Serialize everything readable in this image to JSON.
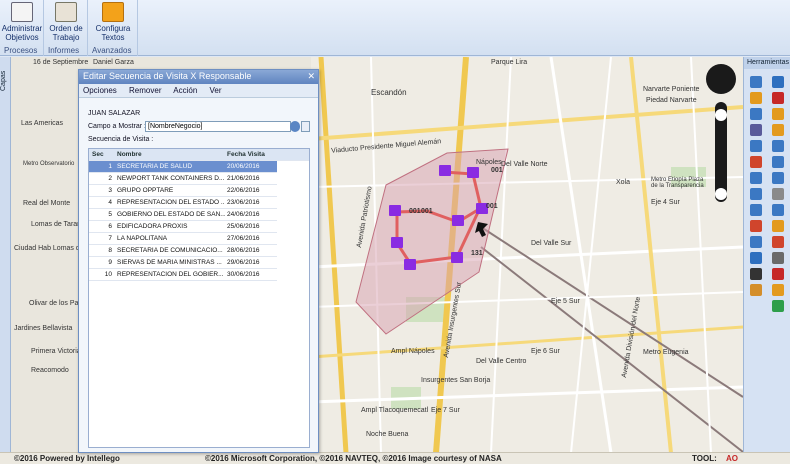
{
  "ribbon": {
    "groups": [
      {
        "label": "Procesos",
        "buttons": [
          {
            "label": "Administrar Objetivos",
            "icon": "clipboard-icon"
          }
        ]
      },
      {
        "label": "Informes",
        "buttons": [
          {
            "label": "Orden de Trabajo",
            "icon": "work-order-icon"
          }
        ]
      },
      {
        "label": "Avanzados",
        "buttons": [
          {
            "label": "Configura Textos",
            "icon": "edit-text-icon"
          }
        ]
      }
    ]
  },
  "side_tab": {
    "label": "Capas"
  },
  "tools": {
    "title": "Herramientas"
  },
  "map": {
    "labels": [
      "16 de Septiembre",
      "Daniel Garza",
      "Escandón",
      "Parque Lira",
      "Las Americas",
      "Metro Observatorio",
      "Real del Monte",
      "Lomas de Tarango",
      "Ciudad Hab Lomas de Santa Fe",
      "Olivar de los Padres",
      "Jardines Bellavista",
      "Primera Victoria",
      "Reacomodo",
      "Avenida Patriotismo",
      "Viaducto Presidente Miguel Alemán",
      "Del Valle Norte",
      "Narvarte Poniente",
      "Piedad Narvarte",
      "Metro Etiopía Plaza de la Transparencia",
      "Eje 4 Sur",
      "Xola",
      "Del Valle Sur",
      "Eje 5 Sur",
      "Eje 6 Sur",
      "Ampl Nápoles",
      "Del Valle Centro",
      "Insurgentes San Borja",
      "Metro Eugenia",
      "Noche Buena",
      "Eje 7 Sur",
      "Avenida Insurgentes Sur",
      "Avenida División del Norte",
      "Nápoles",
      "Ampl Tlacoquemecatl"
    ],
    "markers": [
      "001",
      "001",
      "001",
      "131",
      "001"
    ],
    "attribution": "©2016 Microsoft Corporation, ©2016 NAVTEQ, ©2016 Image courtesy of NASA"
  },
  "bottombar": {
    "powered": "©2016 Powered by Intellego",
    "tool_label": "TOOL:",
    "tool_value": "AO"
  },
  "dialog": {
    "title": "Editar Secuencia de Visita X Responsable",
    "menu": [
      "Opciones",
      "Remover",
      "Acción",
      "Ver"
    ],
    "user": "JUAN SALAZAR",
    "field_label": "Campo a Mostrar :",
    "field_value": "[NombreNegocio]",
    "sequence_label": "Secuencia de Visita :",
    "columns": [
      "Sec",
      "Nombre",
      "Fecha Visita"
    ],
    "rows": [
      {
        "sec": "1",
        "nombre": "SECRETARIA DE SALUD",
        "fecha": "20/06/2016"
      },
      {
        "sec": "2",
        "nombre": "NEWPORT TANK CONTAINERS D...",
        "fecha": "21/06/2016"
      },
      {
        "sec": "3",
        "nombre": "GRUPO OPPTARE",
        "fecha": "22/06/2016"
      },
      {
        "sec": "4",
        "nombre": "REPRESENTACION DEL ESTADO ...",
        "fecha": "23/06/2016"
      },
      {
        "sec": "5",
        "nombre": "GOBIERNO DEL ESTADO DE SAN...",
        "fecha": "24/06/2016"
      },
      {
        "sec": "6",
        "nombre": "EDIFICADORA PROXIS",
        "fecha": "25/06/2016"
      },
      {
        "sec": "7",
        "nombre": "LA NAPOLITANA",
        "fecha": "27/06/2016"
      },
      {
        "sec": "8",
        "nombre": "SECRETARIA DE COMUNICACIO...",
        "fecha": "28/06/2016"
      },
      {
        "sec": "9",
        "nombre": "SIERVAS DE MARIA MINISTRAS ...",
        "fecha": "29/06/2016"
      },
      {
        "sec": "10",
        "nombre": "REPRESENTACION DEL GOBIER...",
        "fecha": "30/06/2016"
      }
    ]
  },
  "colors": {
    "route": "#e06060",
    "marker": "#8a2be2",
    "polygon": "#d8a0b0",
    "accent": "#5f84c0"
  }
}
